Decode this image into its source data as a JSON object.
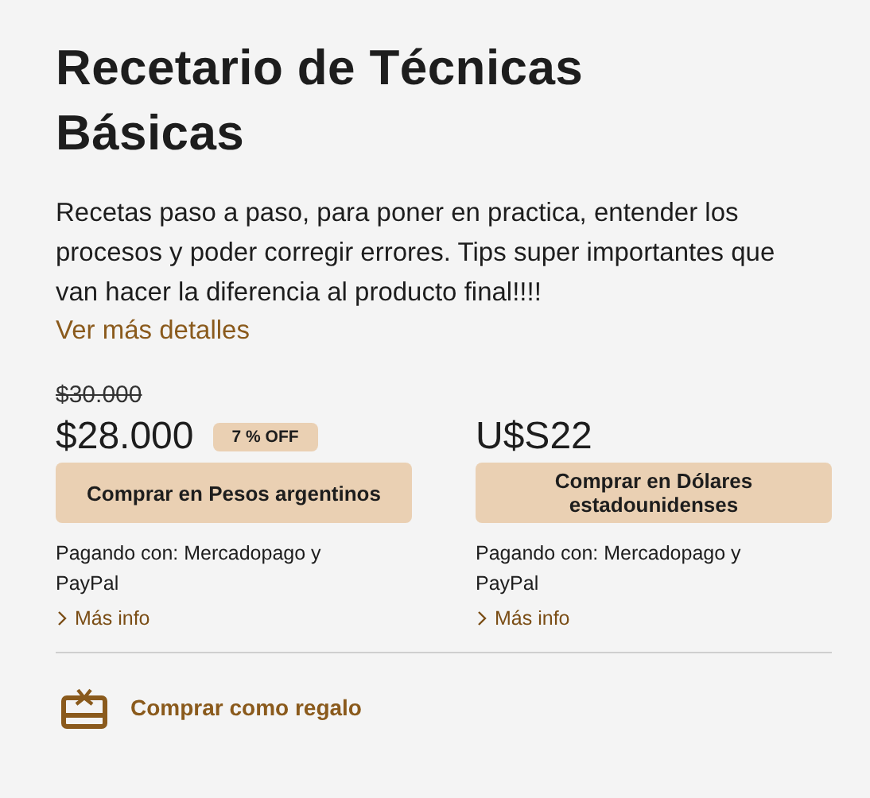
{
  "title": "Recetario de Técnicas Básicas",
  "description": "Recetas paso a paso, para poner en practica, entender los procesos y poder corregir errores. Tips super importantes que van hacer la diferencia al producto final!!!!",
  "details_link": "Ver más detalles",
  "options": [
    {
      "old_price": "$30.000",
      "price": "$28.000",
      "badge": "7 % OFF",
      "button": "Comprar en Pesos argentinos",
      "payment": "Pagando con: Mercadopago y PayPal",
      "more_info": "Más info"
    },
    {
      "price": "U$S22",
      "button": "Comprar en Dólares estadounidenses",
      "payment": "Pagando con: Mercadopago y PayPal",
      "more_info": "Más info"
    }
  ],
  "gift": "Comprar como regalo"
}
